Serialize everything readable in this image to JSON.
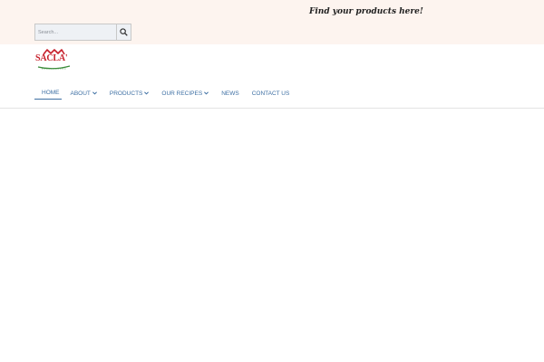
{
  "topbar": {
    "title": "Find your products here!",
    "search": {
      "placeholder": "Search...",
      "button_icon": "search-icon"
    }
  },
  "header": {
    "logo": {
      "text": "SACLA'",
      "icon": "sacla-logo"
    },
    "nav": [
      {
        "label": "HOME",
        "active": true,
        "dropdown": false
      },
      {
        "label": "ABOUT",
        "active": false,
        "dropdown": true
      },
      {
        "label": "PRODUCTS",
        "active": false,
        "dropdown": true
      },
      {
        "label": "OUR RECIPES",
        "active": false,
        "dropdown": true
      },
      {
        "label": "NEWS",
        "active": false,
        "dropdown": false
      },
      {
        "label": "CONTACT US",
        "active": false,
        "dropdown": false
      }
    ]
  },
  "colors": {
    "topbar_bg": "#fdf4ef",
    "nav_link": "#3d6fa3",
    "brand_red": "#c7202b",
    "brand_green": "#3b8c3a"
  }
}
